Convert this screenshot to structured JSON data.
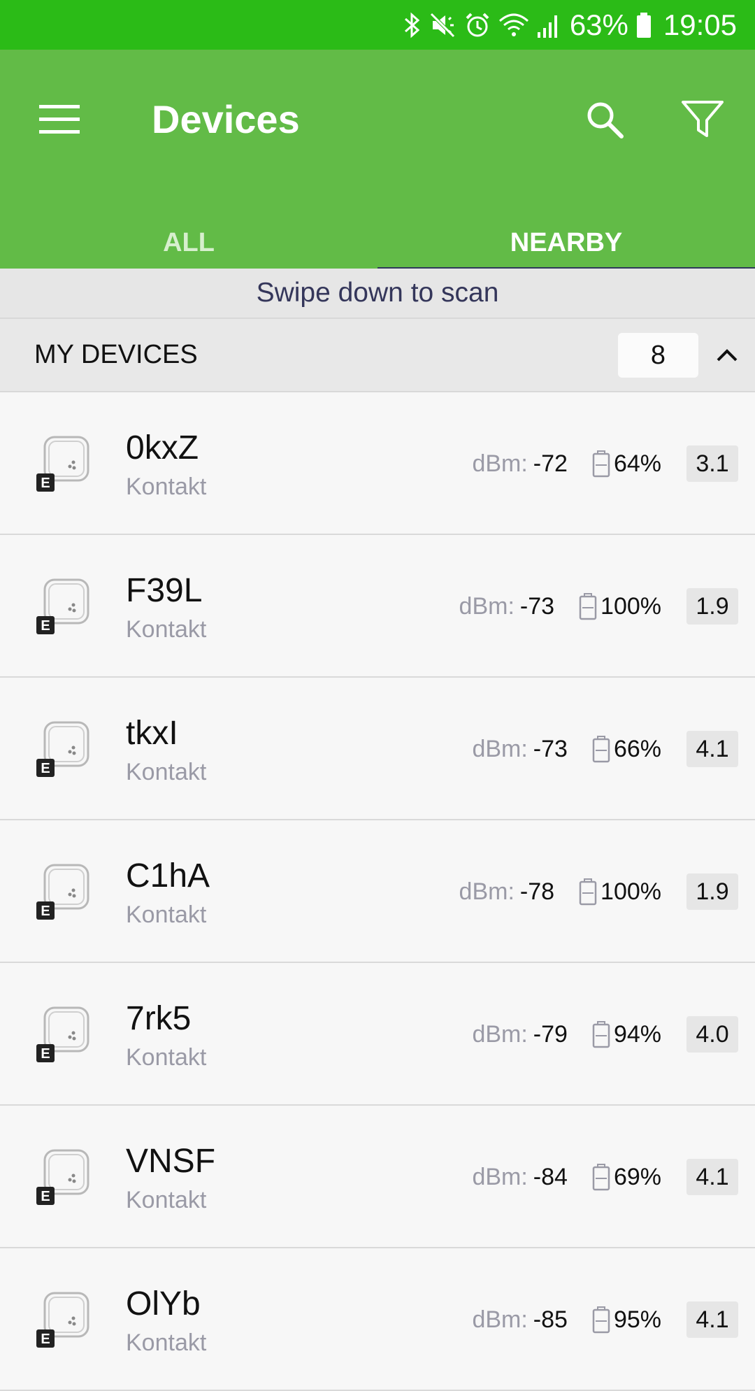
{
  "status_bar": {
    "battery_percent": "63%",
    "time": "19:05",
    "icons": [
      "bluetooth-icon",
      "mute-icon",
      "alarm-icon",
      "wifi-icon",
      "signal-icon",
      "battery-icon"
    ]
  },
  "app_bar": {
    "title": "Devices",
    "menu_icon": "menu-icon",
    "search_icon": "search-icon",
    "filter_icon": "filter-icon",
    "color": "#62bb47"
  },
  "tabs": [
    {
      "label": "ALL",
      "active": false
    },
    {
      "label": "NEARBY",
      "active": true
    }
  ],
  "scan_hint": "Swipe down to scan",
  "section": {
    "title": "MY DEVICES",
    "count": "8",
    "toggle_icon": "chevron-up-icon"
  },
  "devices": [
    {
      "name": "0kxZ",
      "vendor": "Kontakt",
      "dbm_label": "dBm:",
      "dbm": "-72",
      "battery": "64%",
      "version": "3.1"
    },
    {
      "name": "F39L",
      "vendor": "Kontakt",
      "dbm_label": "dBm:",
      "dbm": "-73",
      "battery": "100%",
      "version": "1.9"
    },
    {
      "name": "tkxI",
      "vendor": "Kontakt",
      "dbm_label": "dBm:",
      "dbm": "-73",
      "battery": "66%",
      "version": "4.1"
    },
    {
      "name": "C1hA",
      "vendor": "Kontakt",
      "dbm_label": "dBm:",
      "dbm": "-78",
      "battery": "100%",
      "version": "1.9"
    },
    {
      "name": "7rk5",
      "vendor": "Kontakt",
      "dbm_label": "dBm:",
      "dbm": "-79",
      "battery": "94%",
      "version": "4.0"
    },
    {
      "name": "VNSF",
      "vendor": "Kontakt",
      "dbm_label": "dBm:",
      "dbm": "-84",
      "battery": "69%",
      "version": "4.1"
    },
    {
      "name": "OlYb",
      "vendor": "Kontakt",
      "dbm_label": "dBm:",
      "dbm": "-85",
      "battery": "95%",
      "version": "4.1"
    }
  ]
}
